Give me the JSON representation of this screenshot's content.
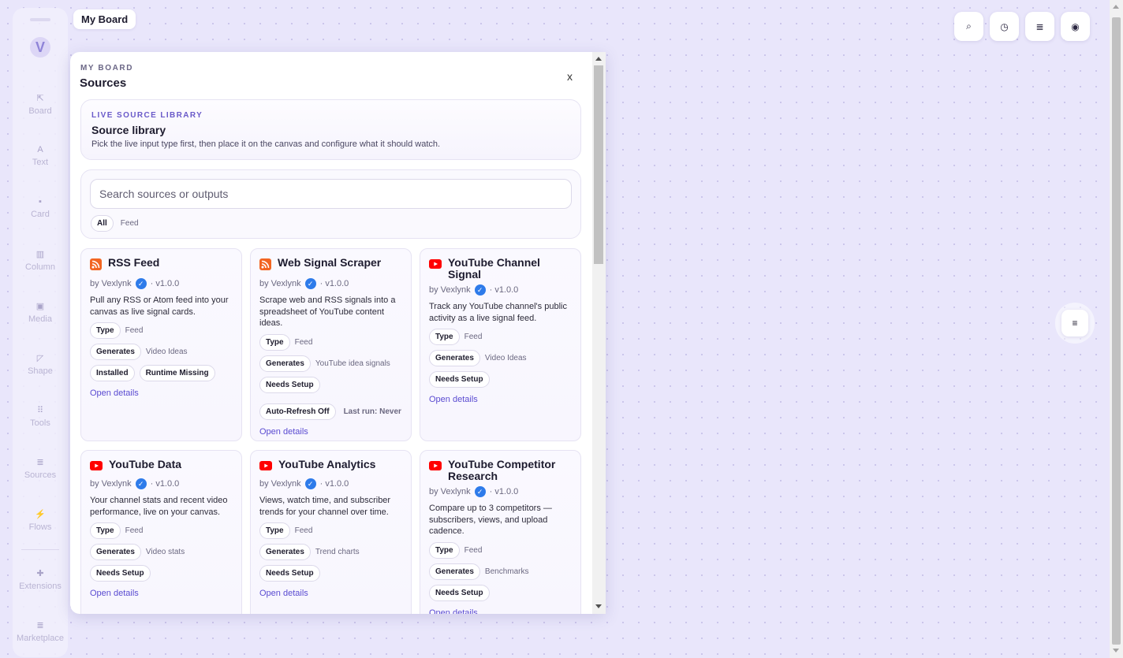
{
  "app": {
    "logo_letter": "V",
    "board_pill": "My Board"
  },
  "rail": [
    {
      "label": "Board",
      "icon": "external-link-icon",
      "glyph": "⇱"
    },
    {
      "label": "Text",
      "icon": "text-icon",
      "glyph": "A"
    },
    {
      "label": "Card",
      "icon": "card-icon",
      "glyph": "▪"
    },
    {
      "label": "Column",
      "icon": "column-icon",
      "glyph": "▥"
    },
    {
      "label": "Media",
      "icon": "media-icon",
      "glyph": "▣"
    },
    {
      "label": "Shape",
      "icon": "shape-icon",
      "glyph": "◸"
    },
    {
      "label": "Tools",
      "icon": "tools-icon",
      "glyph": "⠿"
    },
    {
      "label": "Sources",
      "icon": "database-icon",
      "glyph": "≣"
    },
    {
      "label": "Flows",
      "icon": "bolt-icon",
      "glyph": "⚡"
    },
    {
      "label": "Extensions",
      "icon": "puzzle-icon",
      "glyph": "✚"
    },
    {
      "label": "Marketplace",
      "icon": "stack-icon",
      "glyph": "≣"
    }
  ],
  "top_tools": [
    {
      "name": "search-button",
      "icon": "search-icon",
      "glyph": "⌕"
    },
    {
      "name": "history-button",
      "icon": "clock-icon",
      "glyph": "◷"
    },
    {
      "name": "data-button",
      "icon": "database-icon",
      "glyph": "≣"
    },
    {
      "name": "account-button",
      "icon": "user-icon",
      "glyph": "◉"
    }
  ],
  "side_tool": {
    "icon": "align-center-icon",
    "glyph": "≡"
  },
  "panel": {
    "eyebrow": "MY BOARD",
    "title": "Sources",
    "close_label": "x",
    "library": {
      "eyebrow": "LIVE SOURCE LIBRARY",
      "title": "Source library",
      "description": "Pick the live input type first, then place it on the canvas and configure what it should watch."
    },
    "search": {
      "placeholder": "Search sources or outputs",
      "value": "",
      "filters": [
        "All",
        "Feed"
      ]
    },
    "labels": {
      "type": "Type",
      "generates": "Generates",
      "details": "Open details"
    },
    "sources": [
      {
        "title": "RSS Feed",
        "icon": "rss-icon",
        "author": "by Vexlynk",
        "version": "· v1.0.0",
        "description": "Pull any RSS or Atom feed into your canvas as live signal cards.",
        "type": "Feed",
        "generates": "Video Ideas",
        "status": [
          "Installed",
          "Runtime Missing"
        ],
        "extra": null
      },
      {
        "title": "Web Signal Scraper",
        "icon": "rss-icon",
        "author": "by Vexlynk",
        "version": "· v1.0.0",
        "description": "Scrape web and RSS signals into a spreadsheet of YouTube content ideas.",
        "type": "Feed",
        "generates": "YouTube idea signals",
        "status": [
          "Needs Setup"
        ],
        "extra": {
          "refresh": "Auto-Refresh Off",
          "last_run": "Last run: Never"
        }
      },
      {
        "title": "YouTube Channel Signal",
        "icon": "youtube-icon",
        "author": "by Vexlynk",
        "version": "· v1.0.0",
        "description": "Track any YouTube channel's public activity as a live signal feed.",
        "type": "Feed",
        "generates": "Video Ideas",
        "status": [
          "Needs Setup"
        ],
        "extra": null
      },
      {
        "title": "YouTube Data",
        "icon": "youtube-icon",
        "author": "by Vexlynk",
        "version": "· v1.0.0",
        "description": "Your channel stats and recent video performance, live on your canvas.",
        "type": "Feed",
        "generates": "Video stats",
        "status": [
          "Needs Setup"
        ],
        "extra": null
      },
      {
        "title": "YouTube Analytics",
        "icon": "youtube-icon",
        "author": "by Vexlynk",
        "version": "· v1.0.0",
        "description": "Views, watch time, and subscriber trends for your channel over time.",
        "type": "Feed",
        "generates": "Trend charts",
        "status": [
          "Needs Setup"
        ],
        "extra": null
      },
      {
        "title": "YouTube Competitor Research",
        "icon": "youtube-icon",
        "author": "by Vexlynk",
        "version": "· v1.0.0",
        "description": "Compare up to 3 competitors — subscribers, views, and upload cadence.",
        "type": "Feed",
        "generates": "Benchmarks",
        "status": [
          "Needs Setup"
        ],
        "extra": null
      }
    ]
  },
  "colors": {
    "accent": "#5a4bd1",
    "rss": "#f26522",
    "youtube": "#ff0000",
    "verified": "#2e7bea",
    "canvas": "#e9e6fb"
  }
}
